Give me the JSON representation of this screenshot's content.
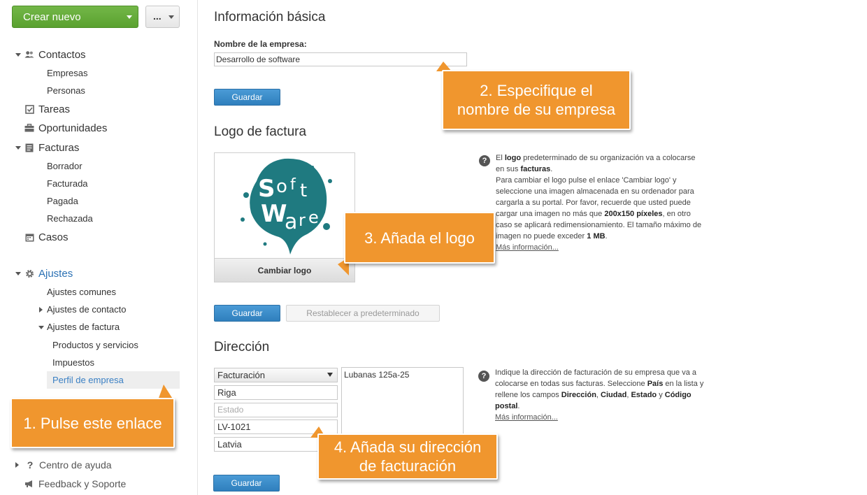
{
  "sidebar": {
    "create_button": "Crear nuevo",
    "more_button": "...",
    "items": {
      "contactos": "Contactos",
      "empresas": "Empresas",
      "personas": "Personas",
      "tareas": "Tareas",
      "oportunidades": "Oportunidades",
      "facturas": "Facturas",
      "borrador": "Borrador",
      "facturada": "Facturada",
      "pagada": "Pagada",
      "rechazada": "Rechazada",
      "casos": "Casos",
      "ajustes": "Ajustes",
      "ajustes_comunes": "Ajustes comunes",
      "ajustes_contacto": "Ajustes de contacto",
      "ajustes_factura": "Ajustes de factura",
      "productos": "Productos y servicios",
      "impuestos": "Impuestos",
      "perfil_empresa": "Perfil de empresa",
      "centro_ayuda": "Centro de ayuda",
      "feedback": "Feedback y Soporte"
    }
  },
  "basic": {
    "title": "Información básica",
    "name_label": "Nombre de la empresa:",
    "name_value": "Desarrollo de software",
    "save": "Guardar"
  },
  "logo": {
    "title": "Logo de factura",
    "change_button": "Cambiar logo",
    "save": "Guardar",
    "reset": "Restablecer a predeterminado",
    "logo_letters": "SoftWare",
    "help": {
      "p1_a": "El ",
      "p1_b": "logo",
      "p1_c": " predeterminado de su organización va a colocarse en sus ",
      "p1_d": "facturas",
      "p1_e": ".",
      "p2_a": "Para cambiar el logo pulse el enlace 'Cambiar logo' y seleccione una imagen almacenada en su ordenador para cargarla a su portal. Por favor, recuerde que usted puede cargar una imagen no más que ",
      "p2_b": "200x150 píxeles",
      "p2_c": ", en otro caso se aplicará redimensionamiento. El tamaño máximo de imagen no puede exceder ",
      "p2_d": "1 MB",
      "p2_e": ".",
      "more": "Más información..."
    }
  },
  "address": {
    "title": "Dirección",
    "type_select": "Facturación",
    "city": "Riga",
    "state_placeholder": "Estado",
    "postal": "LV-1021",
    "country": "Latvia",
    "street": "Lubanas  125a-25",
    "save": "Guardar",
    "help": {
      "a": "Indique la dirección de facturación de su empresa que va a colocarse en todas sus facturas. Seleccione ",
      "b": "País",
      "c": " en la lista y rellene los campos ",
      "d": "Dirección",
      "e": ", ",
      "f": "Ciudad",
      "g": ", ",
      "h": "Estado",
      "i": " y ",
      "j": "Código postal",
      "k": ".",
      "more": "Más información..."
    }
  },
  "callouts": {
    "c1": "1. Pulse este enlace",
    "c2_line1": "2. Especifique el",
    "c2_line2": "nombre de su empresa",
    "c3": "3. Añada el logo",
    "c4_line1": "4. Añada su dirección",
    "c4_line2": "de facturación"
  },
  "colors": {
    "accent_green": "#5aa12f",
    "button_blue": "#2f7fbd",
    "callout_orange": "#f0962e",
    "logo_teal": "#1f7a80"
  }
}
